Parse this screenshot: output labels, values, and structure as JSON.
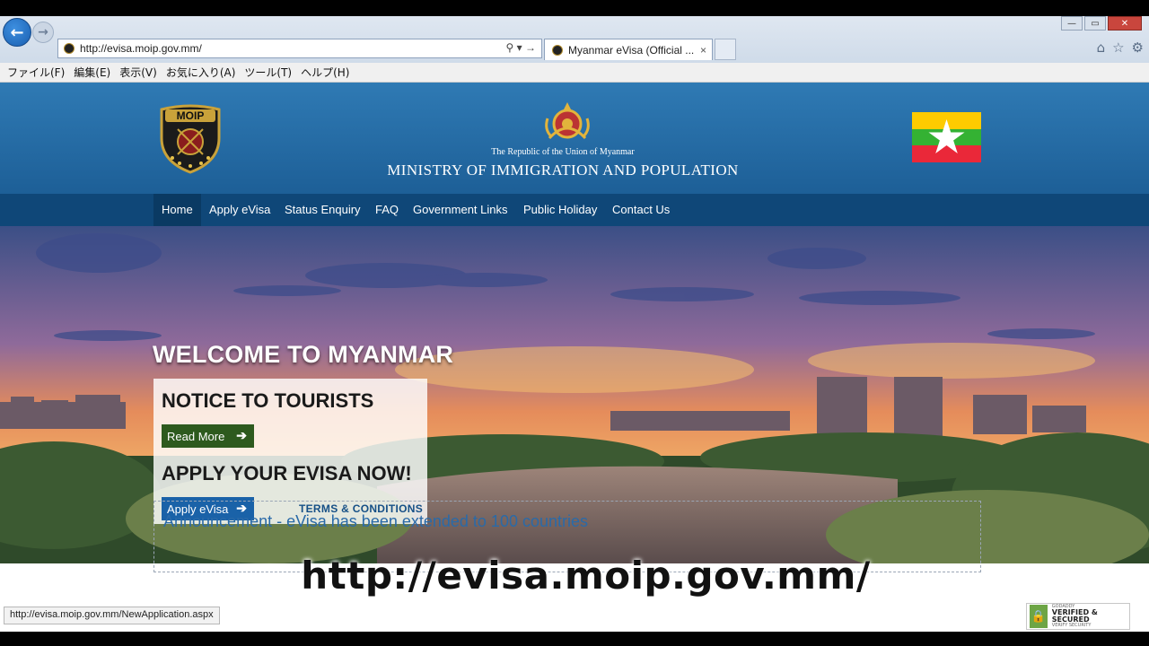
{
  "browser": {
    "url": "http://evisa.moip.gov.mm/",
    "tab_title": "Myanmar eVisa (Official ...",
    "tab_close": "×",
    "menu": [
      "ファイル(F)",
      "編集(E)",
      "表示(V)",
      "お気に入り(A)",
      "ツール(T)",
      "ヘルプ(H)"
    ],
    "status_url": "http://evisa.moip.gov.mm/NewApplication.aspx"
  },
  "header": {
    "logo_text": "MOIP",
    "republic": "The Republic of the Union of Myanmar",
    "ministry": "MINISTRY OF IMMIGRATION AND POPULATION"
  },
  "nav": [
    "Home",
    "Apply eVisa",
    "Status Enquiry",
    "FAQ",
    "Government Links",
    "Public Holiday",
    "Contact Us"
  ],
  "hero": {
    "welcome": "WELCOME TO MYANMAR",
    "notice_title": "NOTICE TO TOURISTS",
    "read_more": "Read More",
    "apply_title": "APPLY YOUR EVISA NOW!",
    "apply_button": "Apply eVisa",
    "terms": "TERMS & CONDITIONS"
  },
  "announcement": "Announcement - eVisa has been extended to 100 countries",
  "overlay_url": "http://evisa.moip.gov.mm/",
  "godaddy": {
    "l1": "GODADDY",
    "l2": "VERIFIED & SECURED",
    "l3": "VERIFY SECURITY"
  },
  "colors": {
    "header": "#1d5f97",
    "navbar": "#0f4778",
    "read_more": "#2d5a1e",
    "apply": "#1a62a8"
  },
  "icons": [
    "back-icon",
    "forward-icon",
    "search-icon",
    "refresh-icon",
    "home-icon",
    "star-icon",
    "gear-icon",
    "arrow-right-icon"
  ]
}
